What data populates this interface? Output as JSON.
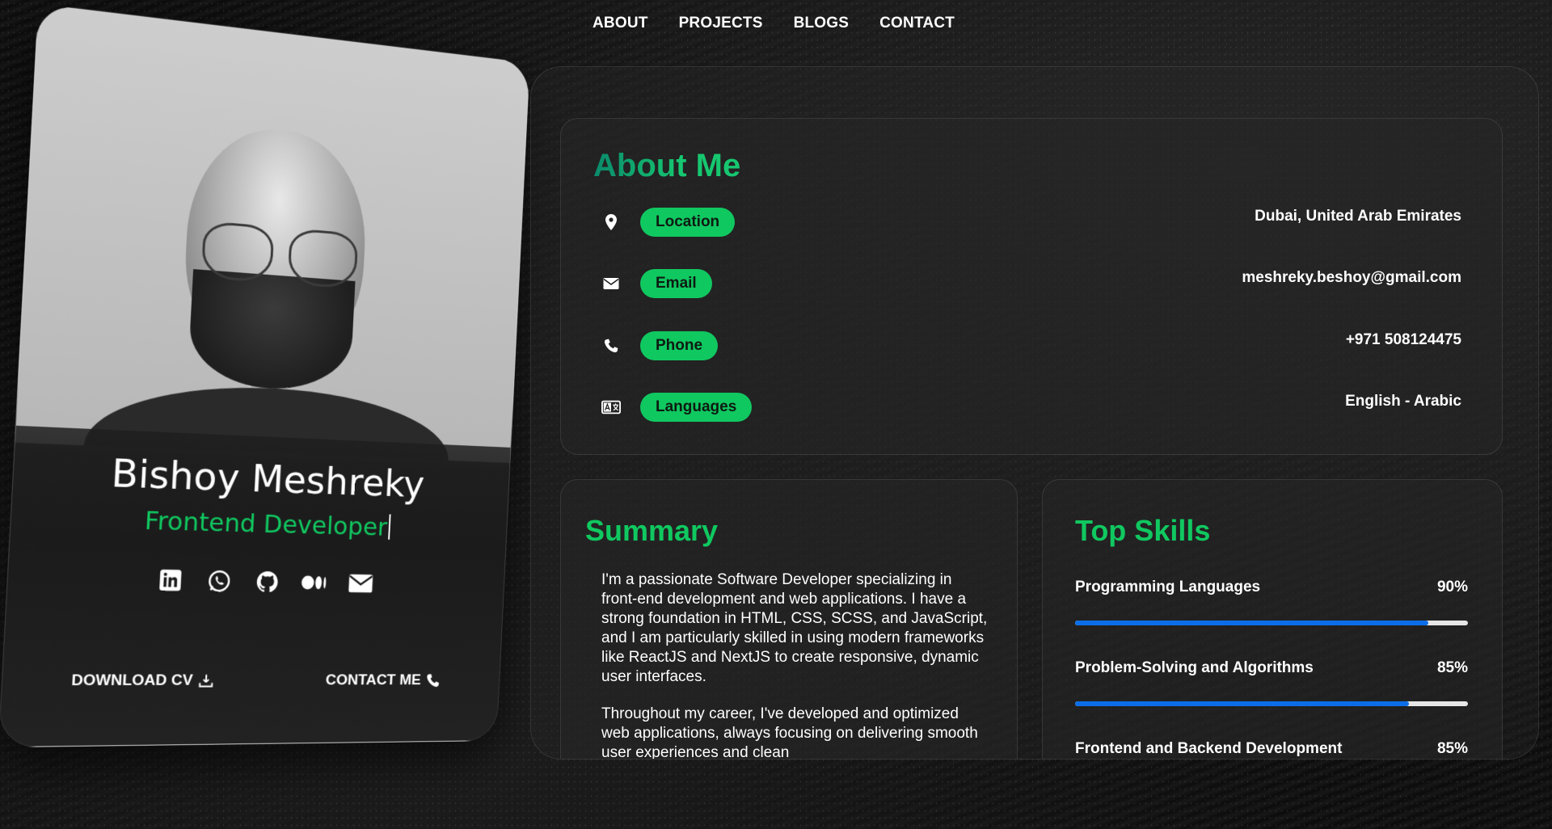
{
  "nav": {
    "items": [
      "ABOUT",
      "PROJECTS",
      "BLOGS",
      "CONTACT"
    ]
  },
  "profile": {
    "name": "Bishoy Meshreky",
    "role": "Frontend Developer",
    "socials": [
      "linkedin-icon",
      "whatsapp-icon",
      "github-icon",
      "medium-icon",
      "email-icon"
    ],
    "download_cv": "DOWNLOAD CV",
    "contact_me": "CONTACT ME"
  },
  "about": {
    "title": "About Me",
    "rows": [
      {
        "icon": "location-pin-icon",
        "label": "Location",
        "value": "Dubai, United Arab Emirates"
      },
      {
        "icon": "envelope-icon",
        "label": "Email",
        "value": "meshreky.beshoy@gmail.com"
      },
      {
        "icon": "phone-icon",
        "label": "Phone",
        "value": "+971 508124475"
      },
      {
        "icon": "language-icon",
        "label": "Languages",
        "value": "English - Arabic"
      }
    ]
  },
  "summary": {
    "title": "Summary",
    "paragraphs": [
      "I'm a passionate Software Developer specializing in front-end development and web applications. I have a strong foundation in HTML, CSS, SCSS, and JavaScript, and I am particularly skilled in using modern frameworks like ReactJS and NextJS to create responsive, dynamic user interfaces.",
      "Throughout my career, I've developed and optimized web applications, always focusing on delivering smooth user experiences and clean"
    ]
  },
  "skills": {
    "title": "Top Skills",
    "items": [
      {
        "name": "Programming Languages",
        "percent_label": "90%",
        "level": 0.9
      },
      {
        "name": "Problem-Solving and Algorithms",
        "percent_label": "85%",
        "level": 0.85
      },
      {
        "name": "Frontend and Backend Development",
        "percent_label": "85%",
        "level": 0.85
      }
    ]
  },
  "colors": {
    "accent": "#10c860",
    "bar": "#0b6ee8",
    "background": "#0f0f0f"
  }
}
